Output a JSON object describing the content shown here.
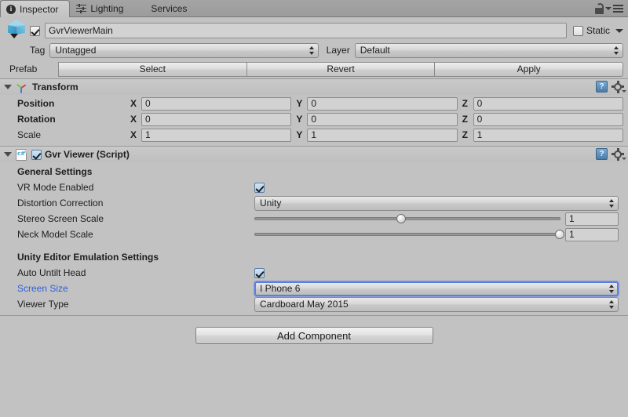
{
  "tabs": [
    {
      "label": "Inspector",
      "icon": "info-icon",
      "active": true
    },
    {
      "label": "Lighting",
      "icon": "sliders-icon",
      "active": false
    },
    {
      "label": "Services",
      "icon": "none",
      "active": false
    }
  ],
  "window": {
    "lock_icon": "padlock-open-icon",
    "menu_icon": "hamburger-menu-icon"
  },
  "gameobject": {
    "icon": "cube-icon",
    "enabled": true,
    "name": "GvrViewerMain",
    "static_label": "Static",
    "static_checked": false,
    "tag_label": "Tag",
    "tag_value": "Untagged",
    "layer_label": "Layer",
    "layer_value": "Default",
    "prefab_label": "Prefab",
    "prefab_buttons": [
      "Select",
      "Revert",
      "Apply"
    ]
  },
  "transform": {
    "icon": "axis-gizmo-icon",
    "title": "Transform",
    "help_icon": "help-book-icon",
    "gear_icon": "gear-icon",
    "rows": [
      {
        "label": "Position",
        "bold": true,
        "x": "0",
        "y": "0",
        "z": "0"
      },
      {
        "label": "Rotation",
        "bold": true,
        "x": "0",
        "y": "0",
        "z": "0"
      },
      {
        "label": "Scale",
        "bold": false,
        "x": "1",
        "y": "1",
        "z": "1"
      }
    ],
    "axis_labels": [
      "X",
      "Y",
      "Z"
    ]
  },
  "gvr_viewer": {
    "icon": "csharp-script-icon",
    "enabled": true,
    "title": "Gvr Viewer (Script)",
    "help_icon": "help-book-icon",
    "gear_icon": "gear-icon",
    "general_section": "General Settings",
    "vr_mode_label": "VR Mode Enabled",
    "vr_mode_checked": true,
    "distortion_label": "Distortion Correction",
    "distortion_value": "Unity",
    "stereo_label": "Stereo Screen Scale",
    "stereo_value": "1",
    "stereo_percent": 48,
    "neck_label": "Neck Model Scale",
    "neck_value": "1",
    "neck_percent": 100,
    "emulation_section": "Unity Editor Emulation Settings",
    "auto_untilt_label": "Auto Untilt Head",
    "auto_untilt_checked": true,
    "screen_size_label": "Screen Size",
    "screen_size_value": "I Phone 6",
    "screen_size_focused": true,
    "viewer_type_label": "Viewer Type",
    "viewer_type_value": "Cardboard May 2015"
  },
  "footer": {
    "add_component_label": "Add Component"
  },
  "colors": {
    "panel_bg": "#c2c2c2",
    "field_bg": "#d2d2d2",
    "accent_blue": "#2f5fd6",
    "focus_blue": "#5b7ee0"
  }
}
